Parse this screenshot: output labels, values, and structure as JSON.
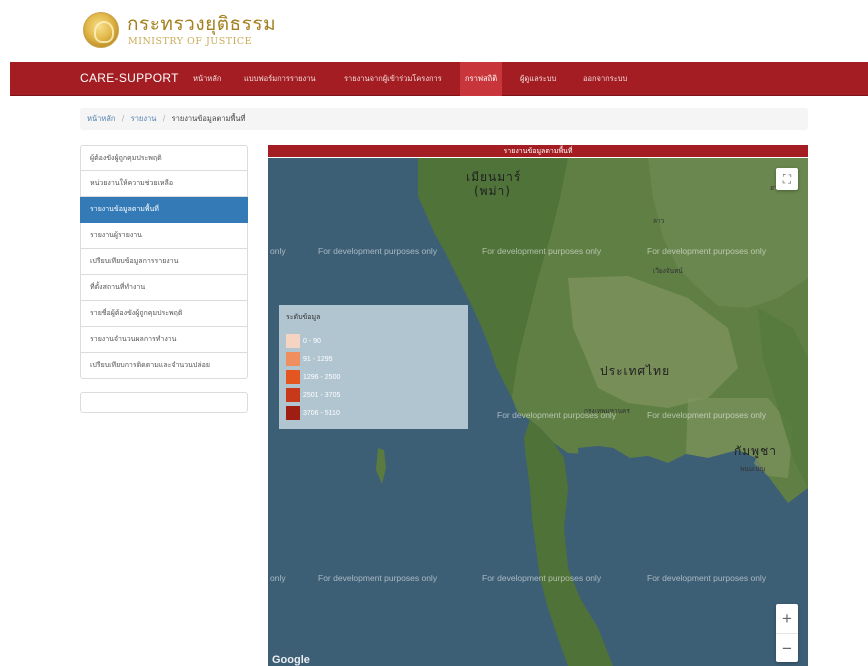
{
  "header": {
    "logo_th": "กระทรวงยุติธรรม",
    "logo_en": "MINISTRY OF JUSTICE"
  },
  "navbar": {
    "brand": "CARE-SUPPORT",
    "items": [
      {
        "label": "หน้าหลัก"
      },
      {
        "label": "แบบฟอร์มการรายงาน"
      },
      {
        "label": "รายงานจากผู้เข้าร่วมโครงการ"
      },
      {
        "label": "กราฟสถิติ",
        "active": true
      },
      {
        "label": "ผู้ดูแลระบบ"
      },
      {
        "label": "ออกจากระบบ"
      }
    ]
  },
  "breadcrumb": {
    "home": "หน้าหลัก",
    "section": "รายงาน",
    "current": "รายงานข้อมูลตามพื้นที่"
  },
  "sidebar": {
    "items": [
      {
        "label": "ผู้ต้องขังผู้ถูกคุมประพฤติ"
      },
      {
        "label": "หน่วยงานให้ความช่วยเหลือ"
      },
      {
        "label": "รายงานข้อมูลตามพื้นที่",
        "active": true
      },
      {
        "label": "รายงานผู้รายงาน"
      },
      {
        "label": "เปรียบเทียบข้อมูลการรายงาน"
      },
      {
        "label": "ที่ตั้งสถานที่ทำงาน"
      },
      {
        "label": "รายชื่อผู้ต้องขังผู้ถูกคุมประพฤติ"
      },
      {
        "label": "รายงานจำนวนผลการทำงาน"
      },
      {
        "label": "เปรียบเทียบการติดตามและจำนวนปล่อย"
      }
    ]
  },
  "map": {
    "title": "รายงานข้อมูลตามพื้นที่",
    "watermark": "For development purposes only",
    "watermark_short": "only",
    "labels": {
      "myanmar": "เมียนมาร์",
      "myanmar_sub": "(พม่า)",
      "thailand": "ประเทศไทย",
      "cambodia": "กัมพูชา",
      "bangkok": "กรุงเทพมหานคร",
      "laos": "ลาว",
      "vientiane": "เวียงจันทน์",
      "hanoi": "ฮานอย",
      "phnom_penh": "พนมเปญ"
    },
    "zoom_in": "+",
    "zoom_out": "−",
    "fullscreen_icon": "⛶",
    "google": "Google"
  },
  "legend": {
    "title": "ระดับข้อมูล",
    "items": [
      {
        "label": "0 - 90",
        "color": "#f6d4c2"
      },
      {
        "label": "91 - 1295",
        "color": "#ef8f5f"
      },
      {
        "label": "1296 - 2500",
        "color": "#e3561f"
      },
      {
        "label": "2501 - 3705",
        "color": "#c8381a"
      },
      {
        "label": "3706 - 5110",
        "color": "#9e1e14"
      }
    ]
  }
}
